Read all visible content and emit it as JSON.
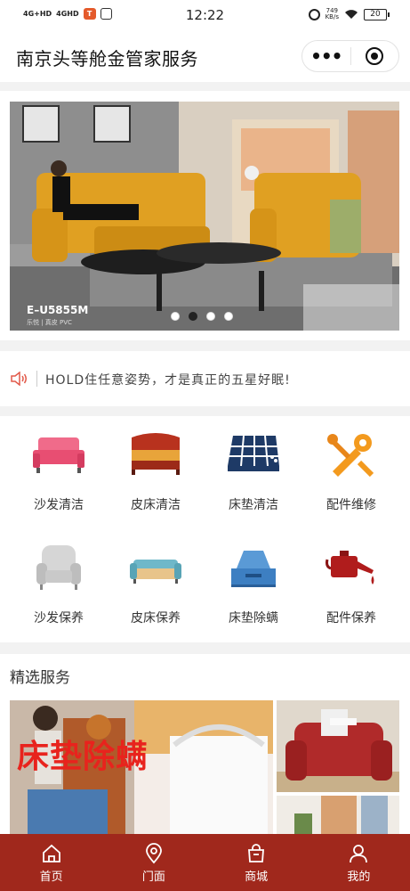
{
  "status_bar": {
    "signal_1": "4G+HD",
    "signal_2": "4GHD",
    "time": "12:22",
    "net_speed_value": "749",
    "net_speed_unit": "KB/s",
    "battery": "20"
  },
  "nav": {
    "title": "南京头等舱金管家服务",
    "more_label": "•••"
  },
  "banner": {
    "model_code": "E–U5855M",
    "model_sub": "乐悦 | 真皮 PVC",
    "slide_count": 4,
    "active_slide": 2
  },
  "notice": {
    "text": "HOLD住任意姿势，才是真正的五星好眠!"
  },
  "services": [
    {
      "label": "沙发清洁",
      "icon": "sofa-icon"
    },
    {
      "label": "皮床清洁",
      "icon": "bed-icon"
    },
    {
      "label": "床垫清洁",
      "icon": "mattress-icon"
    },
    {
      "label": "配件维修",
      "icon": "wrench-icon"
    },
    {
      "label": "沙发保养",
      "icon": "armchair-icon"
    },
    {
      "label": "皮床保养",
      "icon": "sofa-bed-icon"
    },
    {
      "label": "床垫除螨",
      "icon": "mite-remover-icon"
    },
    {
      "label": "配件保养",
      "icon": "oil-can-icon"
    }
  ],
  "featured": {
    "title": "精选服务",
    "main_text": "床垫除螨"
  },
  "tabs": [
    {
      "label": "首页",
      "icon": "home-icon"
    },
    {
      "label": "门面",
      "icon": "location-icon"
    },
    {
      "label": "商城",
      "icon": "shop-bag-icon"
    },
    {
      "label": "我的",
      "icon": "user-icon"
    }
  ],
  "colors": {
    "tab_bar": "#a0281c",
    "accent_red": "#e8231d",
    "background": "#f2f2f2"
  }
}
